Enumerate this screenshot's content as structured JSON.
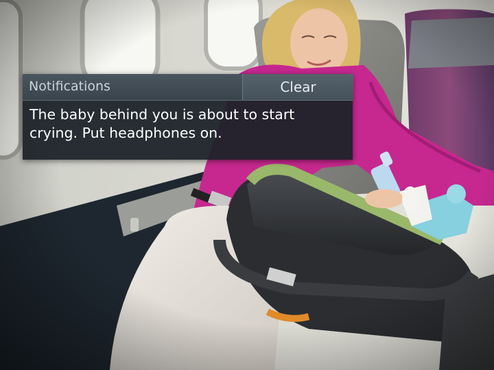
{
  "notification": {
    "title": "Notifications",
    "clear_label": "Clear",
    "message": "The baby behind you is about to start crying.  Put headphones on."
  },
  "scene": {
    "description_icons": [
      "airplane-window",
      "woman-in-seat",
      "baby-car-seat",
      "baby-bottle"
    ]
  },
  "colors": {
    "sweater": "#c6288f",
    "panel_bg": "#1c2228",
    "header_bg": "#4a565f",
    "seat": "#8c8c86",
    "carrier_trim": "#9ab86a"
  }
}
